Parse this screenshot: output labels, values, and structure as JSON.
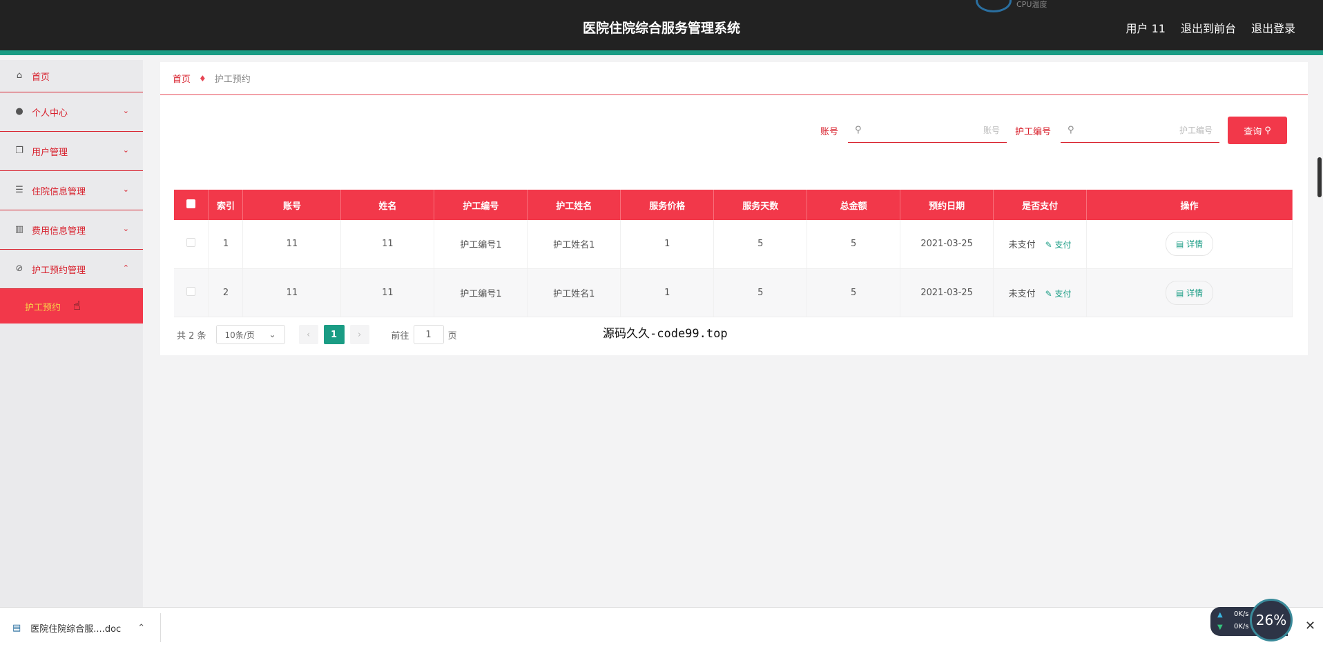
{
  "header": {
    "title": "医院住院综合服务管理系统",
    "cpu_label": "CPU温度",
    "user": "用户 11",
    "exit_front": "退出到前台",
    "logout": "退出登录"
  },
  "sidebar": {
    "items": [
      {
        "label": "首页",
        "icon": "home-icon"
      },
      {
        "label": "个人中心",
        "icon": "user-icon"
      },
      {
        "label": "用户管理",
        "icon": "copy-icon"
      },
      {
        "label": "住院信息管理",
        "icon": "list-icon"
      },
      {
        "label": "费用信息管理",
        "icon": "chart-icon"
      },
      {
        "label": "护工预约管理",
        "icon": "compass-icon"
      }
    ],
    "sub_active": "护工预约"
  },
  "breadcrumb": {
    "home": "首页",
    "current": "护工预约"
  },
  "search": {
    "account_label": "账号",
    "account_placeholder": "账号",
    "nurse_label": "护工编号",
    "nurse_placeholder": "护工编号",
    "button": "查询"
  },
  "table": {
    "headers": [
      "索引",
      "账号",
      "姓名",
      "护工编号",
      "护工姓名",
      "服务价格",
      "服务天数",
      "总金额",
      "预约日期",
      "是否支付",
      "操作"
    ],
    "rows": [
      {
        "index": "1",
        "account": "11",
        "name": "11",
        "nurse_no": "护工编号1",
        "nurse_name": "护工姓名1",
        "price": "1",
        "days": "5",
        "total": "5",
        "date": "2021-03-25",
        "paid": "未支付",
        "pay_action": "支付",
        "detail": "详情"
      },
      {
        "index": "2",
        "account": "11",
        "name": "11",
        "nurse_no": "护工编号1",
        "nurse_name": "护工姓名1",
        "price": "1",
        "days": "5",
        "total": "5",
        "date": "2021-03-25",
        "paid": "未支付",
        "pay_action": "支付",
        "detail": "详情"
      }
    ]
  },
  "pager": {
    "total": "共 2 条",
    "size": "10条/页",
    "current": "1",
    "goto_label": "前往",
    "goto_value": "1",
    "page_unit": "页"
  },
  "overlay_text": "源码久久-code99.top",
  "taskbar": {
    "file": "医院住院综合服....doc",
    "net_up": "0K/s",
    "net_down": "0K/s",
    "gauge": "26%"
  }
}
